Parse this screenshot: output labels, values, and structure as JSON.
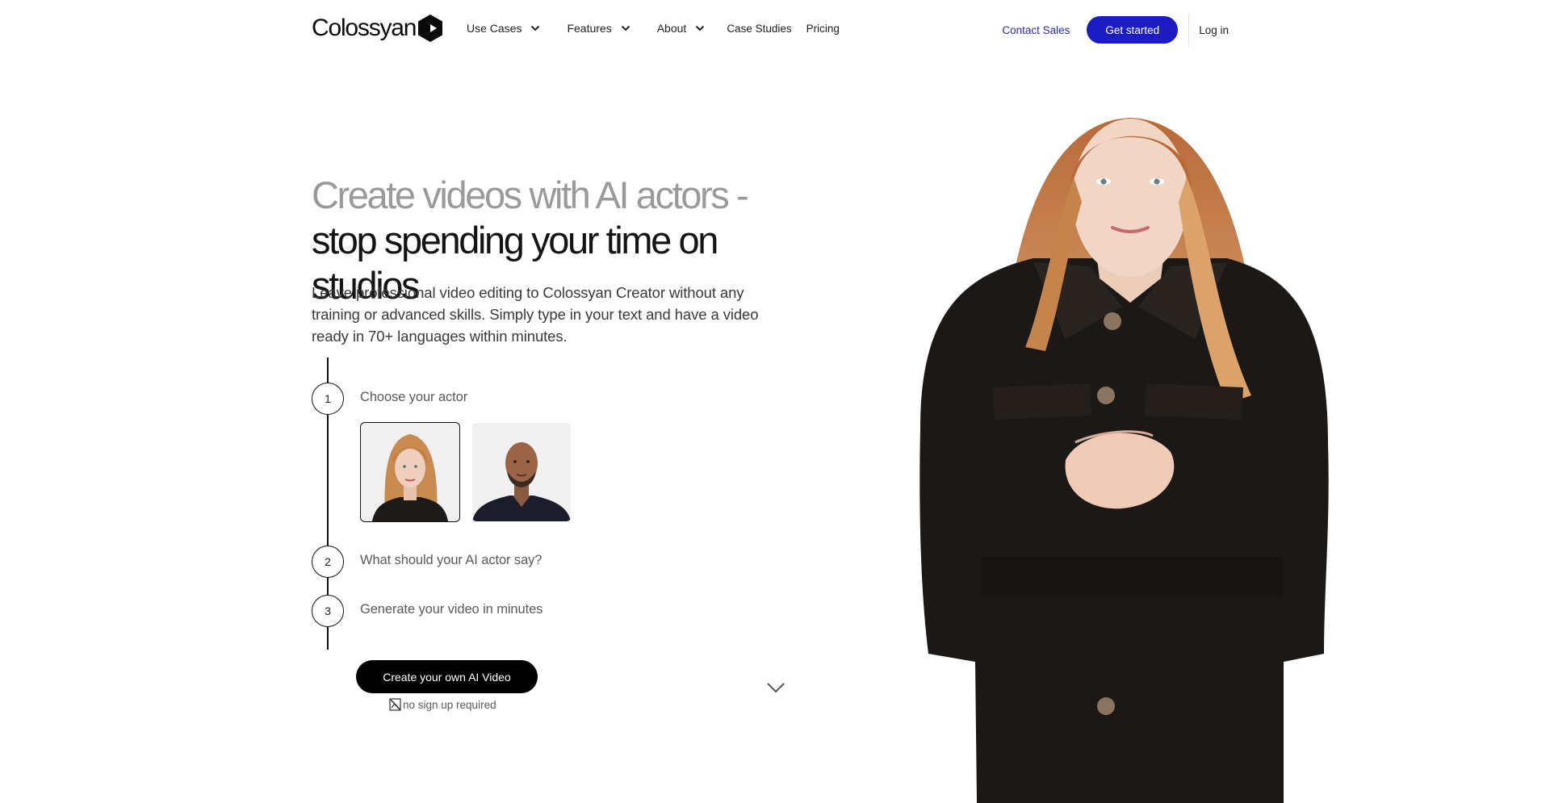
{
  "brand": {
    "name": "Colossyan",
    "logo_icon": "colossyan-play-hexagon-icon",
    "primary_color": "#1c1cc3",
    "link_color": "#2b2bb0"
  },
  "nav": {
    "menu": [
      {
        "label": "Use Cases",
        "dropdown": true,
        "icon": "chevron-down-icon"
      },
      {
        "label": "Features",
        "dropdown": true,
        "icon": "chevron-down-icon"
      },
      {
        "label": "About",
        "dropdown": true,
        "icon": "chevron-down-icon"
      },
      {
        "label": "Case Studies",
        "dropdown": false
      },
      {
        "label": "Pricing",
        "dropdown": false
      }
    ],
    "contact_sales": "Contact Sales",
    "get_started": "Get started",
    "log_in": "Log in"
  },
  "hero": {
    "headline_line1": "Create videos with AI actors -",
    "headline_line2": "stop spending your time on studios",
    "lead": "Leave professional video editing to Colossyan Creator without any training or advanced skills. Simply type in your text and have a video ready in 70+ languages within minutes.",
    "steps": [
      {
        "number": "1",
        "label": "Choose your actor"
      },
      {
        "number": "2",
        "label": "What should your AI actor say?"
      },
      {
        "number": "3",
        "label": "Generate your video in minutes"
      }
    ],
    "actors": [
      {
        "name": "female-actor-red-hair",
        "selected": true
      },
      {
        "name": "male-actor-beard",
        "selected": false
      }
    ],
    "cta": "Create your own AI Video",
    "cta_note": "no sign up required",
    "cta_note_icon": "broken-image-icon",
    "scroll_icon": "chevron-down-icon",
    "hero_image": "ai-actor-woman-portrait"
  }
}
